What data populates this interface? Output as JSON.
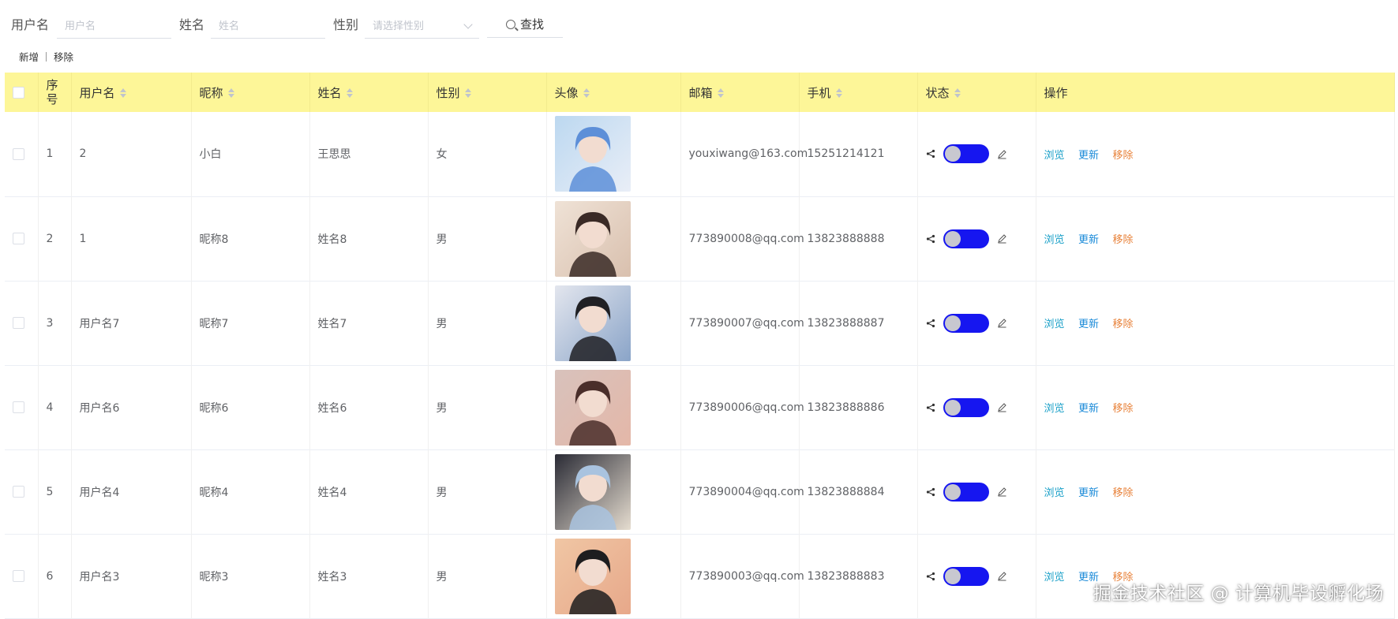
{
  "search": {
    "username_label": "用户名",
    "username_placeholder": "用户名",
    "name_label": "姓名",
    "name_placeholder": "姓名",
    "gender_label": "性别",
    "gender_placeholder": "请选择性别",
    "search_button": "查找"
  },
  "actions": {
    "add": "新增",
    "remove": "移除"
  },
  "table": {
    "headers": {
      "seq": "序号",
      "username": "用户名",
      "nickname": "昵称",
      "name": "姓名",
      "gender": "性别",
      "avatar": "头像",
      "email": "邮箱",
      "phone": "手机",
      "status": "状态",
      "operation": "操作"
    },
    "row_actions": {
      "view": "浏览",
      "update": "更新",
      "remove": "移除"
    },
    "rows": [
      {
        "seq": "1",
        "username": "2",
        "nickname": "小白",
        "name": "王思思",
        "gender": "女",
        "email": "youxiwang@163.com",
        "phone": "15251214121"
      },
      {
        "seq": "2",
        "username": "1",
        "nickname": "昵称8",
        "name": "姓名8",
        "gender": "男",
        "email": "773890008@qq.com",
        "phone": "13823888888"
      },
      {
        "seq": "3",
        "username": "用户名7",
        "nickname": "昵称7",
        "name": "姓名7",
        "gender": "男",
        "email": "773890007@qq.com",
        "phone": "13823888887"
      },
      {
        "seq": "4",
        "username": "用户名6",
        "nickname": "昵称6",
        "name": "姓名6",
        "gender": "男",
        "email": "773890006@qq.com",
        "phone": "13823888886"
      },
      {
        "seq": "5",
        "username": "用户名4",
        "nickname": "昵称4",
        "name": "姓名4",
        "gender": "男",
        "email": "773890004@qq.com",
        "phone": "13823888884"
      },
      {
        "seq": "6",
        "username": "用户名3",
        "nickname": "昵称3",
        "name": "姓名3",
        "gender": "男",
        "email": "773890003@qq.com",
        "phone": "13823888883"
      }
    ]
  },
  "colors": {
    "header_bg": "#fdf698",
    "switch_on": "#1616f0",
    "view_link": "#1aa0c8",
    "update_link": "#1a8ad8",
    "remove_link": "#e8823a"
  },
  "watermark": "掘金技术社区 @ 计算机毕设孵化场"
}
